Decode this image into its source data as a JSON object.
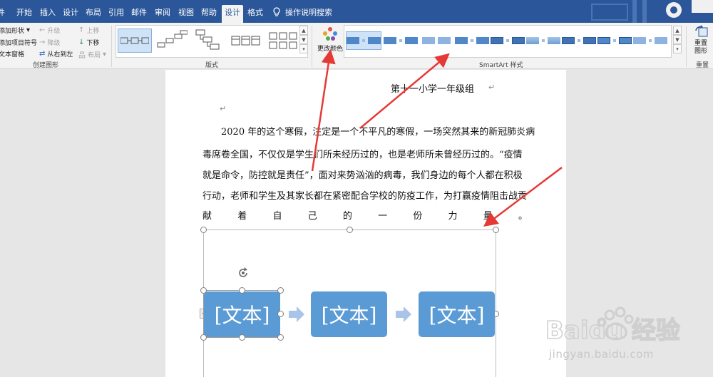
{
  "tabs": [
    "件",
    "开始",
    "插入",
    "设计",
    "布局",
    "引用",
    "邮件",
    "审阅",
    "视图",
    "帮助",
    "设计",
    "格式"
  ],
  "active_tab_index": 10,
  "tell_me": "操作说明搜索",
  "create_graphic": {
    "label": "创建图形",
    "add_shape": "添加形状",
    "add_bullet": "添加项目符号",
    "text_pane": "文本窗格",
    "promote": "升级",
    "demote": "降级",
    "right_to_left": "从右到左",
    "move_up": "上移",
    "move_down": "下移",
    "layout": "布局"
  },
  "layouts_label": "版式",
  "change_colors": "更改颜色",
  "styles_label": "SmartArt 样式",
  "reset": {
    "graphic": "重置图形",
    "label": "重置"
  },
  "document": {
    "title": "第十一小学一年级组",
    "paragraph_lines": [
      "2020 年的这个寒假，注定是一个不平凡的寒假，一场突然其来的新冠肺炎病",
      "毒席卷全国，不仅仅是学生们所未经历过的，也是老师所未曾经历过的。“疫情",
      "就是命令，防控就是责任”，面对来势汹汹的病毒，我们身边的每个人都在积极",
      "行动，老师和学生及其家长都在紧密配合学校的防疫工作，为打赢疫情阻击战贡"
    ],
    "last_line_chars": [
      "献",
      "着",
      "自",
      "己",
      "的",
      "一",
      "份",
      "力",
      "量",
      "。"
    ],
    "paragraph_mark": "↵"
  },
  "smartart": {
    "boxes": [
      "[文本]",
      "[文本]",
      "[文本]"
    ],
    "box_color": "#5b9bd5",
    "arrow_color": "#a9c4e8"
  },
  "watermark": {
    "brand": "Baidu 经验",
    "url": "jingyan.baidu.com"
  },
  "colors": {
    "ribbon_blue": "#2b579a",
    "annotation_red": "#e53935"
  }
}
